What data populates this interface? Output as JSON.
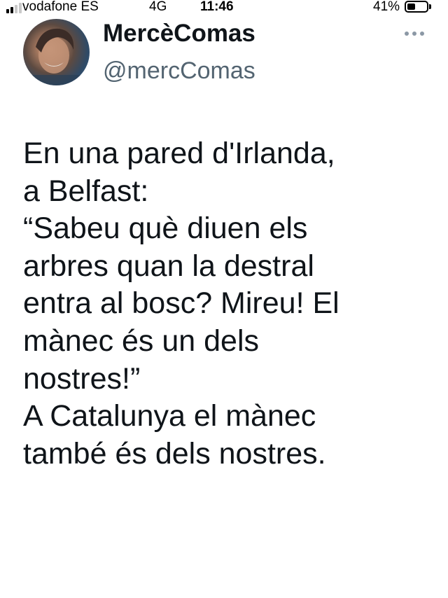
{
  "status_bar": {
    "carrier": "vodafone ES",
    "network": "4G",
    "time": "11:46",
    "battery_percent": "41%",
    "battery_level": 0.41,
    "signal_bars_active": 2,
    "signal_bars_total": 4
  },
  "tweet": {
    "author": {
      "display_name": "MercèComas",
      "handle": "@mercComas",
      "avatar_icon": "profile-photo"
    },
    "more_icon": "more-horizontal-icon",
    "text_lines": [
      "En una pared d'Irlanda,",
      "a Belfast:",
      "“Sabeu què diuen els",
      "arbres quan la destral",
      "entra al bosc? Mireu! El",
      "mànec és un dels",
      "nostres!”",
      "A Catalunya el mànec",
      "també és dels nostres."
    ]
  }
}
